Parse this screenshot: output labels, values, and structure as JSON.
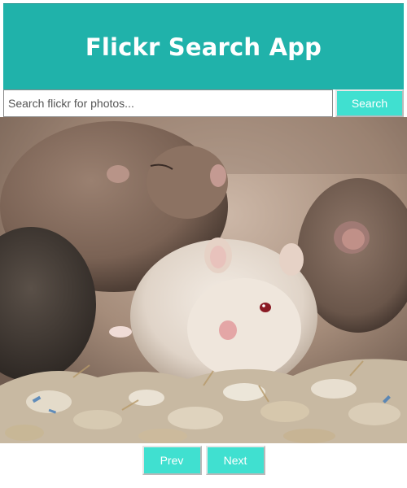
{
  "header": {
    "title": "Flickr Search App",
    "background_color": "#20b2aa"
  },
  "search": {
    "value": "",
    "placeholder": "Search flickr for photos...",
    "button_label": "Search",
    "button_color": "#40e0d0"
  },
  "photo": {
    "alt": "hamsters"
  },
  "pager": {
    "prev_label": "Prev",
    "next_label": "Next"
  }
}
